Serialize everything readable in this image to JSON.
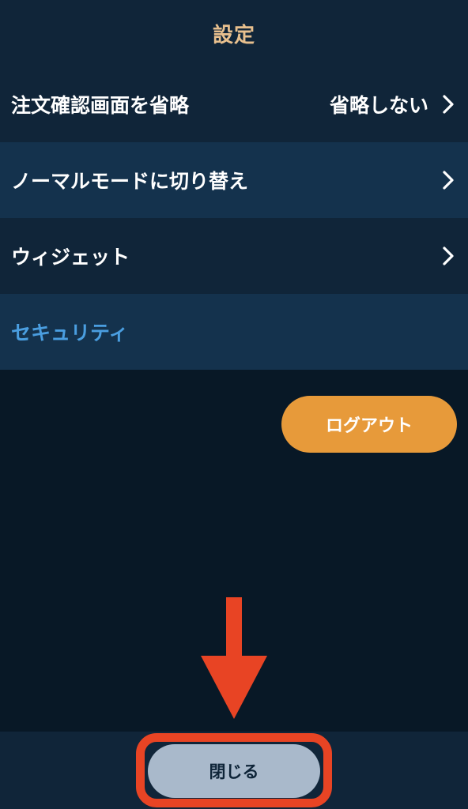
{
  "header": {
    "title": "設定"
  },
  "settings": {
    "rows": [
      {
        "label": "注文確認画面を省略",
        "value": "省略しない",
        "icon": "chevron-right-icon"
      },
      {
        "label": "ノーマルモードに切り替え",
        "icon": "chevron-right-icon"
      },
      {
        "label": "ウィジェット",
        "icon": "chevron-right-icon"
      },
      {
        "label": "セキュリティ"
      }
    ]
  },
  "actions": {
    "logout_label": "ログアウト",
    "close_label": "閉じる"
  },
  "colors": {
    "background": "#081826",
    "header_bg": "#102539",
    "row_dark": "#102539",
    "row_light": "#14324d",
    "title_accent": "#e8c08e",
    "section_accent": "#4a9ee0",
    "logout_bg": "#e79a3a",
    "close_bg": "#a9b9cb",
    "annotation_red": "#e84424"
  }
}
